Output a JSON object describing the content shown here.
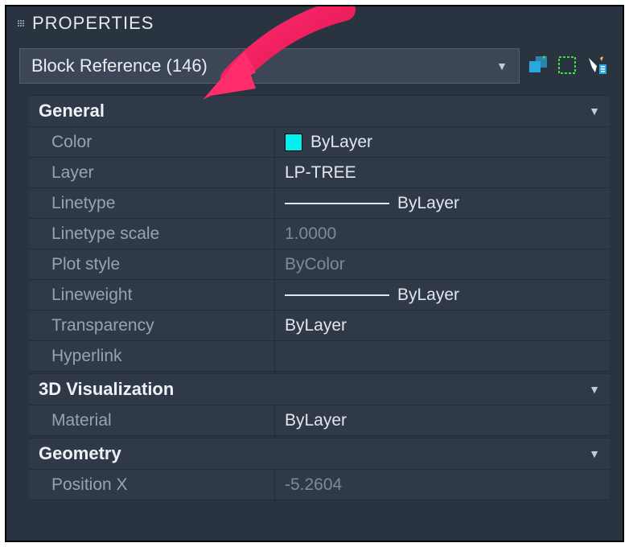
{
  "panel": {
    "title": "PROPERTIES"
  },
  "selector": {
    "value": "Block Reference (146)"
  },
  "sections": {
    "general": {
      "title": "General",
      "rows": {
        "color_label": "Color",
        "color_value": "ByLayer",
        "layer_label": "Layer",
        "layer_value": "LP-TREE",
        "linetype_label": "Linetype",
        "linetype_value": "ByLayer",
        "ltscale_label": "Linetype scale",
        "ltscale_value": "1.0000",
        "plotstyle_label": "Plot style",
        "plotstyle_value": "ByColor",
        "lineweight_label": "Lineweight",
        "lineweight_value": "ByLayer",
        "transparency_label": "Transparency",
        "transparency_value": "ByLayer",
        "hyperlink_label": "Hyperlink",
        "hyperlink_value": ""
      }
    },
    "visualization": {
      "title": "3D Visualization",
      "rows": {
        "material_label": "Material",
        "material_value": "ByLayer"
      }
    },
    "geometry": {
      "title": "Geometry",
      "rows": {
        "posx_label": "Position X",
        "posx_value": "-5.2604"
      }
    }
  },
  "colors": {
    "swatch": "#00f0f0"
  }
}
